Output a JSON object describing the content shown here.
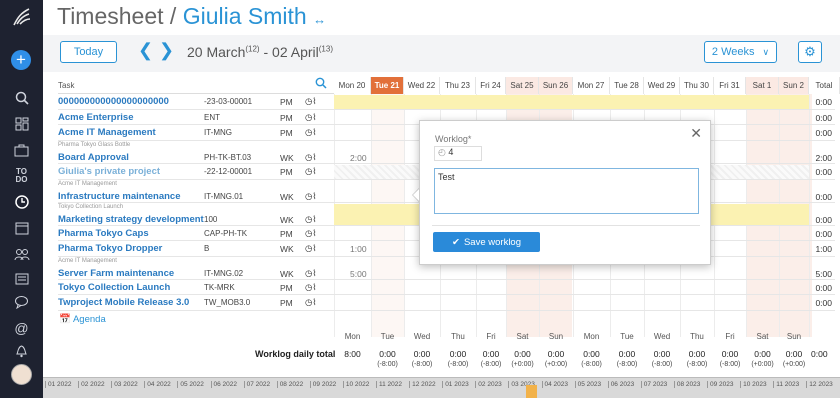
{
  "header": {
    "title": "Timesheet /",
    "user": "Giulia Smith",
    "link_icon": "link-icon"
  },
  "toolbar": {
    "today": "Today",
    "range_start": "20 March",
    "range_start_wk": "(12)",
    "range_sep": " - ",
    "range_end": "02 April",
    "range_end_wk": "(13)",
    "view": "2 Weeks"
  },
  "grid": {
    "task_header": "Task",
    "days": [
      "Mon 20",
      "Tue 21",
      "Wed 22",
      "Thu 23",
      "Fri 24",
      "Sat 25",
      "Sun 26",
      "Mon 27",
      "Tue 28",
      "Wed 29",
      "Thu 30",
      "Fri 31",
      "Sat 1",
      "Sun 2",
      "Total"
    ],
    "rows": [
      {
        "sub": "",
        "name": "000000000000000000000",
        "code": "-23-03-00001",
        "type": "PM",
        "total": "0:00",
        "mon": ""
      },
      {
        "sub": "",
        "name": "Acme Enterprise",
        "code": "ENT",
        "type": "PM",
        "total": "0:00",
        "mon": ""
      },
      {
        "sub": "",
        "name": "Acme IT Management",
        "code": "IT-MNG",
        "type": "PM",
        "total": "0:00",
        "mon": ""
      },
      {
        "sub": "Pharma Tokyo Glass Bottle",
        "name": "Board Approval",
        "code": "PH-TK-BT.03",
        "type": "WK",
        "total": "2:00",
        "mon": "2:00"
      },
      {
        "sub": "",
        "name": "Giulia's private project",
        "code": "-22-12-00001",
        "type": "PM",
        "total": "0:00",
        "mon": ""
      },
      {
        "sub": "Acme IT Management",
        "name": "Infrastructure maintenance",
        "code": "IT-MNG.01",
        "type": "WK",
        "total": "0:00",
        "mon": ""
      },
      {
        "sub": "Tokyo Collection Launch",
        "name": "Marketing strategy development",
        "code": "100",
        "type": "WK",
        "total": "0:00",
        "mon": ""
      },
      {
        "sub": "",
        "name": "Pharma Tokyo Caps",
        "code": "CAP-PH-TK",
        "type": "PM",
        "total": "0:00",
        "mon": ""
      },
      {
        "sub": "",
        "name": "Pharma Tokyo Dropper",
        "code": "B",
        "type": "WK",
        "total": "1:00",
        "mon": "1:00"
      },
      {
        "sub": "Acme IT Management",
        "name": "Server Farm maintenance",
        "code": "IT-MNG.02",
        "type": "WK",
        "total": "5:00",
        "mon": "5:00"
      },
      {
        "sub": "",
        "name": "Tokyo Collection Launch",
        "code": "TK-MRK",
        "type": "PM",
        "total": "0:00",
        "mon": ""
      },
      {
        "sub": "",
        "name": "Twproject Mobile Release 3.0",
        "code": "TW_MOB3.0",
        "type": "PM",
        "total": "0:00",
        "mon": ""
      }
    ],
    "agenda": "Agenda"
  },
  "footer": {
    "label": "Worklog daily total",
    "weekdays": [
      "Mon",
      "Tue",
      "Wed",
      "Thu",
      "Fri",
      "Sat",
      "Sun",
      "Mon",
      "Tue",
      "Wed",
      "Thu",
      "Fri",
      "Sat",
      "Sun"
    ],
    "values": [
      "8:00",
      "0:00",
      "0:00",
      "0:00",
      "0:00",
      "0:00",
      "0:00",
      "0:00",
      "0:00",
      "0:00",
      "0:00",
      "0:00",
      "0:00",
      "0:00"
    ],
    "diffs": [
      "",
      "(-8:00)",
      "(-8:00)",
      "(-8:00)",
      "(-8:00)",
      "(+0:00)",
      "(+0:00)",
      "(-8:00)",
      "(-8:00)",
      "(-8:00)",
      "(-8:00)",
      "(-8:00)",
      "(+0:00)",
      "(+0:00)"
    ],
    "total": "0:00"
  },
  "timeline": [
    "01 2022",
    "02 2022",
    "03 2022",
    "04 2022",
    "05 2022",
    "06 2022",
    "07 2022",
    "08 2022",
    "09 2022",
    "10 2022",
    "11 2022",
    "12 2022",
    "01 2023",
    "02 2023",
    "03 2023",
    "04 2023",
    "05 2023",
    "06 2023",
    "07 2023",
    "08 2023",
    "09 2023",
    "10 2023",
    "11 2023",
    "12 2023"
  ],
  "modal": {
    "label": "Worklog*",
    "hours": "4",
    "comment": "Test",
    "save": "Save worklog"
  },
  "colors": {
    "accent": "#2a93d5",
    "today": "#e2703a",
    "weekend": "#fbe9e3",
    "highlight": "#fbf2b2",
    "sidebar": "#1e2230"
  }
}
